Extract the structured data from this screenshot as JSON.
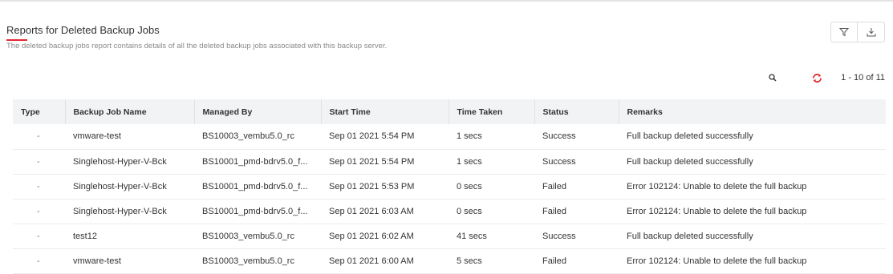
{
  "header": {
    "title": "Reports for Deleted Backup Jobs",
    "subtitle": "The deleted backup jobs report contains details of all the deleted backup jobs associated with this backup server."
  },
  "actions": {
    "filter_icon": "filter-icon",
    "download_icon": "download-icon"
  },
  "toolbar": {
    "search_icon": "search-icon",
    "refresh_icon": "refresh-icon",
    "pagination": "1 - 10 of 11"
  },
  "colors": {
    "accent_red": "#e0292f",
    "header_bg": "#f2f3f5"
  },
  "table": {
    "columns": [
      "Type",
      "Backup Job Name",
      "Managed By",
      "Start Time",
      "Time Taken",
      "Status",
      "Remarks"
    ],
    "rows": [
      [
        "-",
        "vmware-test",
        "BS10003_vembu5.0_rc",
        "Sep 01 2021 5:54 PM",
        "1 secs",
        "Success",
        "Full backup deleted successfully"
      ],
      [
        "-",
        "Singlehost-Hyper-V-Bck",
        "BS10001_pmd-bdrv5.0_f...",
        "Sep 01 2021 5:54 PM",
        "1 secs",
        "Success",
        "Full backup deleted successfully"
      ],
      [
        "-",
        "Singlehost-Hyper-V-Bck",
        "BS10001_pmd-bdrv5.0_f...",
        "Sep 01 2021 5:53 PM",
        "0 secs",
        "Failed",
        "Error 102124: Unable to delete the full backup"
      ],
      [
        "-",
        "Singlehost-Hyper-V-Bck",
        "BS10001_pmd-bdrv5.0_f...",
        "Sep 01 2021 6:03 AM",
        "0 secs",
        "Failed",
        "Error 102124: Unable to delete the full backup"
      ],
      [
        "-",
        "test12",
        "BS10003_vembu5.0_rc",
        "Sep 01 2021 6:02 AM",
        "41 secs",
        "Success",
        "Full backup deleted successfully"
      ],
      [
        "-",
        "vmware-test",
        "BS10003_vembu5.0_rc",
        "Sep 01 2021 6:00 AM",
        "5 secs",
        "Failed",
        "Error 102124: Unable to delete the full backup"
      ]
    ]
  }
}
